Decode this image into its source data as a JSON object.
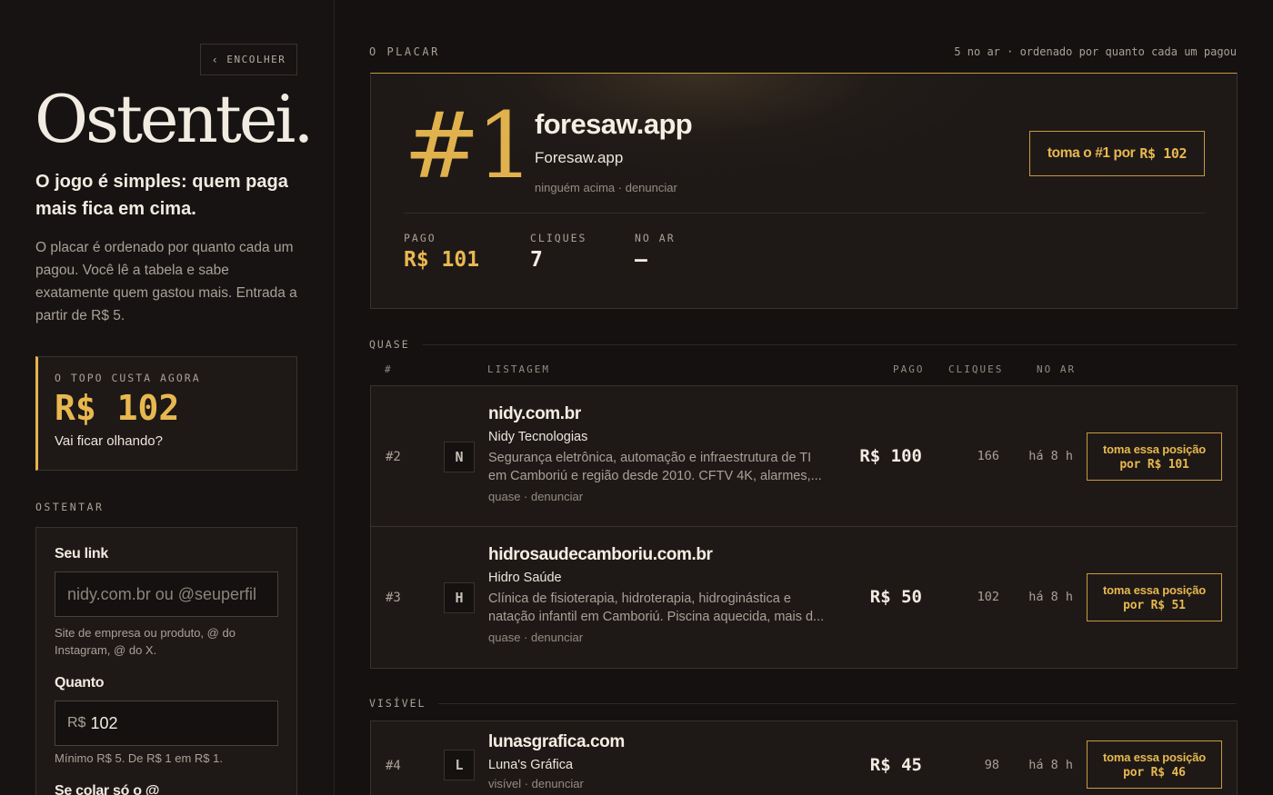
{
  "sidebar": {
    "collapse_label": "ENCOLHER",
    "brand": "Ostentei.",
    "tagline": "O jogo é simples: quem paga mais fica em cima.",
    "intro": "O placar é ordenado por quanto cada um pagou. Você lê a tabela e sabe exatamente quem gastou mais. Entrada a partir de R$ 5.",
    "top_box": {
      "label": "O TOPO CUSTA AGORA",
      "price": "R$ 102",
      "sub": "Vai ficar olhando?"
    },
    "section_label": "OSTENTAR",
    "form": {
      "link_label": "Seu link",
      "link_placeholder": "nidy.com.br ou @seuperfil",
      "link_hint": "Site de empresa ou produto, @ do Instagram, @ do X.",
      "amount_label": "Quanto",
      "amount_prefix": "R$",
      "amount_value": "102",
      "amount_hint": "Mínimo R$ 5. De R$ 1 em R$ 1.",
      "handle_label": "Se colar só o @"
    }
  },
  "board": {
    "title": "O PLACAR",
    "summary": "5 no ar · ordenado por quanto cada um pagou",
    "leader": {
      "rank": "#1",
      "domain": "foresaw.app",
      "name": "Foresaw.app",
      "meta": "ninguém acima · denunciar",
      "take_label": "toma o #1 por",
      "take_amount": "R$ 102",
      "stats": {
        "paid_label": "PAGO",
        "paid_value": "R$ 101",
        "clicks_label": "CLIQUES",
        "clicks_value": "7",
        "air_label": "NO AR",
        "air_value": "—"
      }
    },
    "group_quase": "QUASE",
    "group_visivel": "VISÍVEL",
    "columns": {
      "rank": "#",
      "listing": "LISTAGEM",
      "paid": "PAGO",
      "clicks": "CLIQUES",
      "air": "NO AR"
    },
    "rows_quase": [
      {
        "rank": "#2",
        "initial": "N",
        "domain": "nidy.com.br",
        "name": "Nidy Tecnologias",
        "desc": "Segurança eletrônica, automação e infraestrutura de TI em Camboriú e região desde 2010. CFTV 4K, alarmes,...",
        "meta": "quase · denunciar",
        "paid": "R$ 100",
        "clicks": "166",
        "air": "há 8 h",
        "take_label": "toma essa posição",
        "take_amount": "por R$ 101"
      },
      {
        "rank": "#3",
        "initial": "H",
        "domain": "hidrosaudecamboriu.com.br",
        "name": "Hidro Saúde",
        "desc": "Clínica de fisioterapia, hidroterapia, hidroginástica e natação infantil em Camboriú. Piscina aquecida, mais d...",
        "meta": "quase · denunciar",
        "paid": "R$ 50",
        "clicks": "102",
        "air": "há 8 h",
        "take_label": "toma essa posição",
        "take_amount": "por R$ 51"
      }
    ],
    "rows_visivel": [
      {
        "rank": "#4",
        "initial": "L",
        "domain": "lunasgrafica.com",
        "name": "Luna's Gráfica",
        "meta": "visível · denunciar",
        "paid": "R$ 45",
        "clicks": "98",
        "air": "há 8 h",
        "take_label": "toma essa posição",
        "take_amount": "por R$ 46"
      }
    ]
  },
  "colors": {
    "gold": "#e8b84f",
    "background": "#141110",
    "panel": "#1e1917"
  }
}
